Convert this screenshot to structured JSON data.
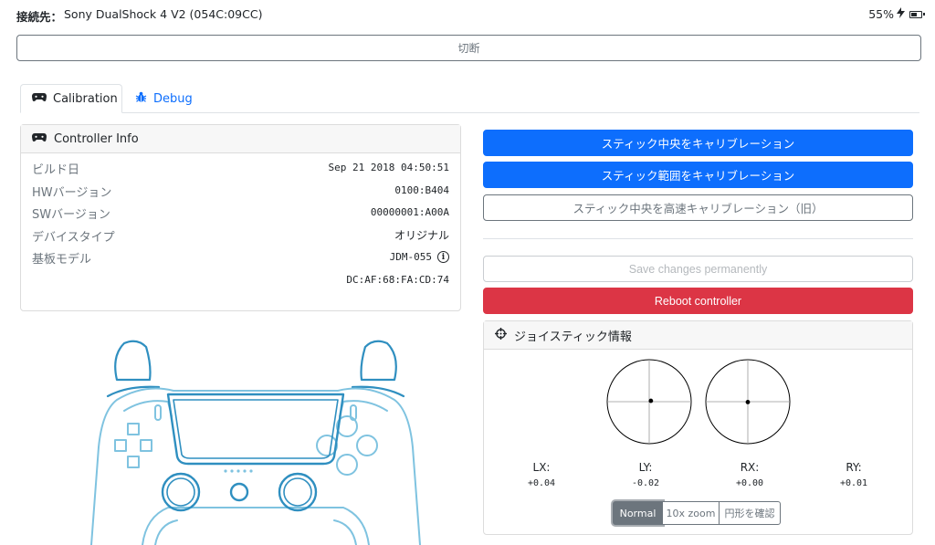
{
  "header": {
    "connection_label": "接続先：",
    "device_name": "Sony DualShock 4 V2 (054C:09CC)",
    "battery_text": "55%",
    "battery_level": 0.55,
    "battery_charging_icon": "bolt-icon"
  },
  "disconnect_label": "切断",
  "tabs": [
    {
      "label": "Calibration",
      "icon": "gamepad-icon",
      "active": true
    },
    {
      "label": "Debug",
      "icon": "bug-icon",
      "active": false
    }
  ],
  "controller_info": {
    "title": "Controller Info",
    "rows": [
      {
        "key": "ビルド日",
        "value": "Sep 21 2018 04:50:51"
      },
      {
        "key": "HWバージョン",
        "value": "0100:B404"
      },
      {
        "key": "SWバージョン",
        "value": "00000001:A00A"
      },
      {
        "key": "デバイスタイプ",
        "value": "オリジナル"
      },
      {
        "key": "基板モデル",
        "value": "JDM-055"
      },
      {
        "key": "",
        "value": "DC:AF:68:FA:CD:74"
      }
    ]
  },
  "actions": {
    "calibrate_center": "スティック中央をキャリブレーション",
    "calibrate_range": "スティック範囲をキャリブレーション",
    "fast_calibrate_center": "スティック中央を高速キャリブレーション（旧）",
    "save_permanently": "Save changes permanently",
    "reboot": "Reboot controller"
  },
  "joystick_info": {
    "title": "ジョイスティック情報",
    "axes": [
      {
        "name": "LX:",
        "value": "+0.04"
      },
      {
        "name": "LY:",
        "value": "-0.02"
      },
      {
        "name": "RX:",
        "value": "+0.00"
      },
      {
        "name": "RY:",
        "value": "+0.01"
      }
    ],
    "left_stick": {
      "x": 0.04,
      "y": -0.02
    },
    "right_stick": {
      "x": 0.0,
      "y": 0.01
    },
    "modes": [
      "Normal",
      "10x zoom",
      "円形を確認"
    ],
    "selected_mode": "Normal"
  },
  "colors": {
    "primary": "#0d6efd",
    "danger": "#dc3545",
    "secondary": "#6c757d",
    "controller_outline": "#2f8fc0"
  }
}
